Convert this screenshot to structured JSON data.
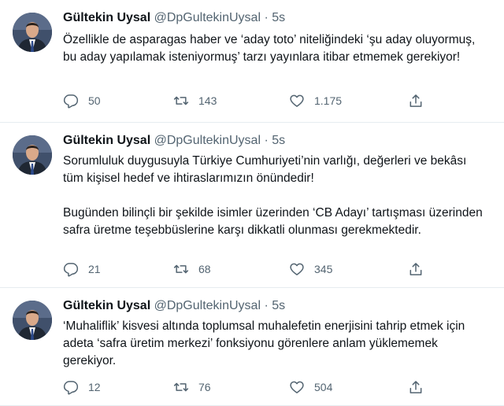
{
  "tweets": [
    {
      "name": "Gültekin Uysal",
      "handle": "@DpGultekinUysal",
      "separator": "·",
      "time": "5s",
      "paragraphs": [
        "Özellikle de asparagas haber ve  ‘aday toto’ niteliğindeki ‘şu aday oluyormuş, bu aday yapılamak isteniyormuş’ tarzı yayınlara itibar etmemek gerekiyor!"
      ],
      "replies": "50",
      "retweets": "143",
      "likes": "1.175"
    },
    {
      "name": "Gültekin Uysal",
      "handle": "@DpGultekinUysal",
      "separator": "·",
      "time": "5s",
      "paragraphs": [
        "Sorumluluk duygusuyla Türkiye Cumhuriyeti’nin varlığı, değerleri ve bekâsı tüm kişisel hedef ve ihtiraslarımızın önündedir!",
        "Bugünden bilinçli bir şekilde isimler üzerinden ‘CB Adayı’ tartışması üzerinden safra üretme teşebbüslerine karşı dikkatli olunması gerekmektedir."
      ],
      "replies": "21",
      "retweets": "68",
      "likes": "345"
    },
    {
      "name": "Gültekin Uysal",
      "handle": "@DpGultekinUysal",
      "separator": "·",
      "time": "5s",
      "paragraphs": [
        "‘Muhaliflik’ kisvesi altında toplumsal muhalefetin enerjisini tahrip etmek için adeta ‘safra üretim merkezi’ fonksiyonu görenlere anlam yüklememek gerekiyor."
      ],
      "replies": "12",
      "retweets": "76",
      "likes": "504"
    }
  ],
  "icons": {
    "reply": "reply-icon",
    "retweet": "retweet-icon",
    "like": "heart-icon",
    "share": "share-icon"
  },
  "colors": {
    "text": "#0f1419",
    "secondary": "#536471",
    "border": "#e6ecf0"
  }
}
